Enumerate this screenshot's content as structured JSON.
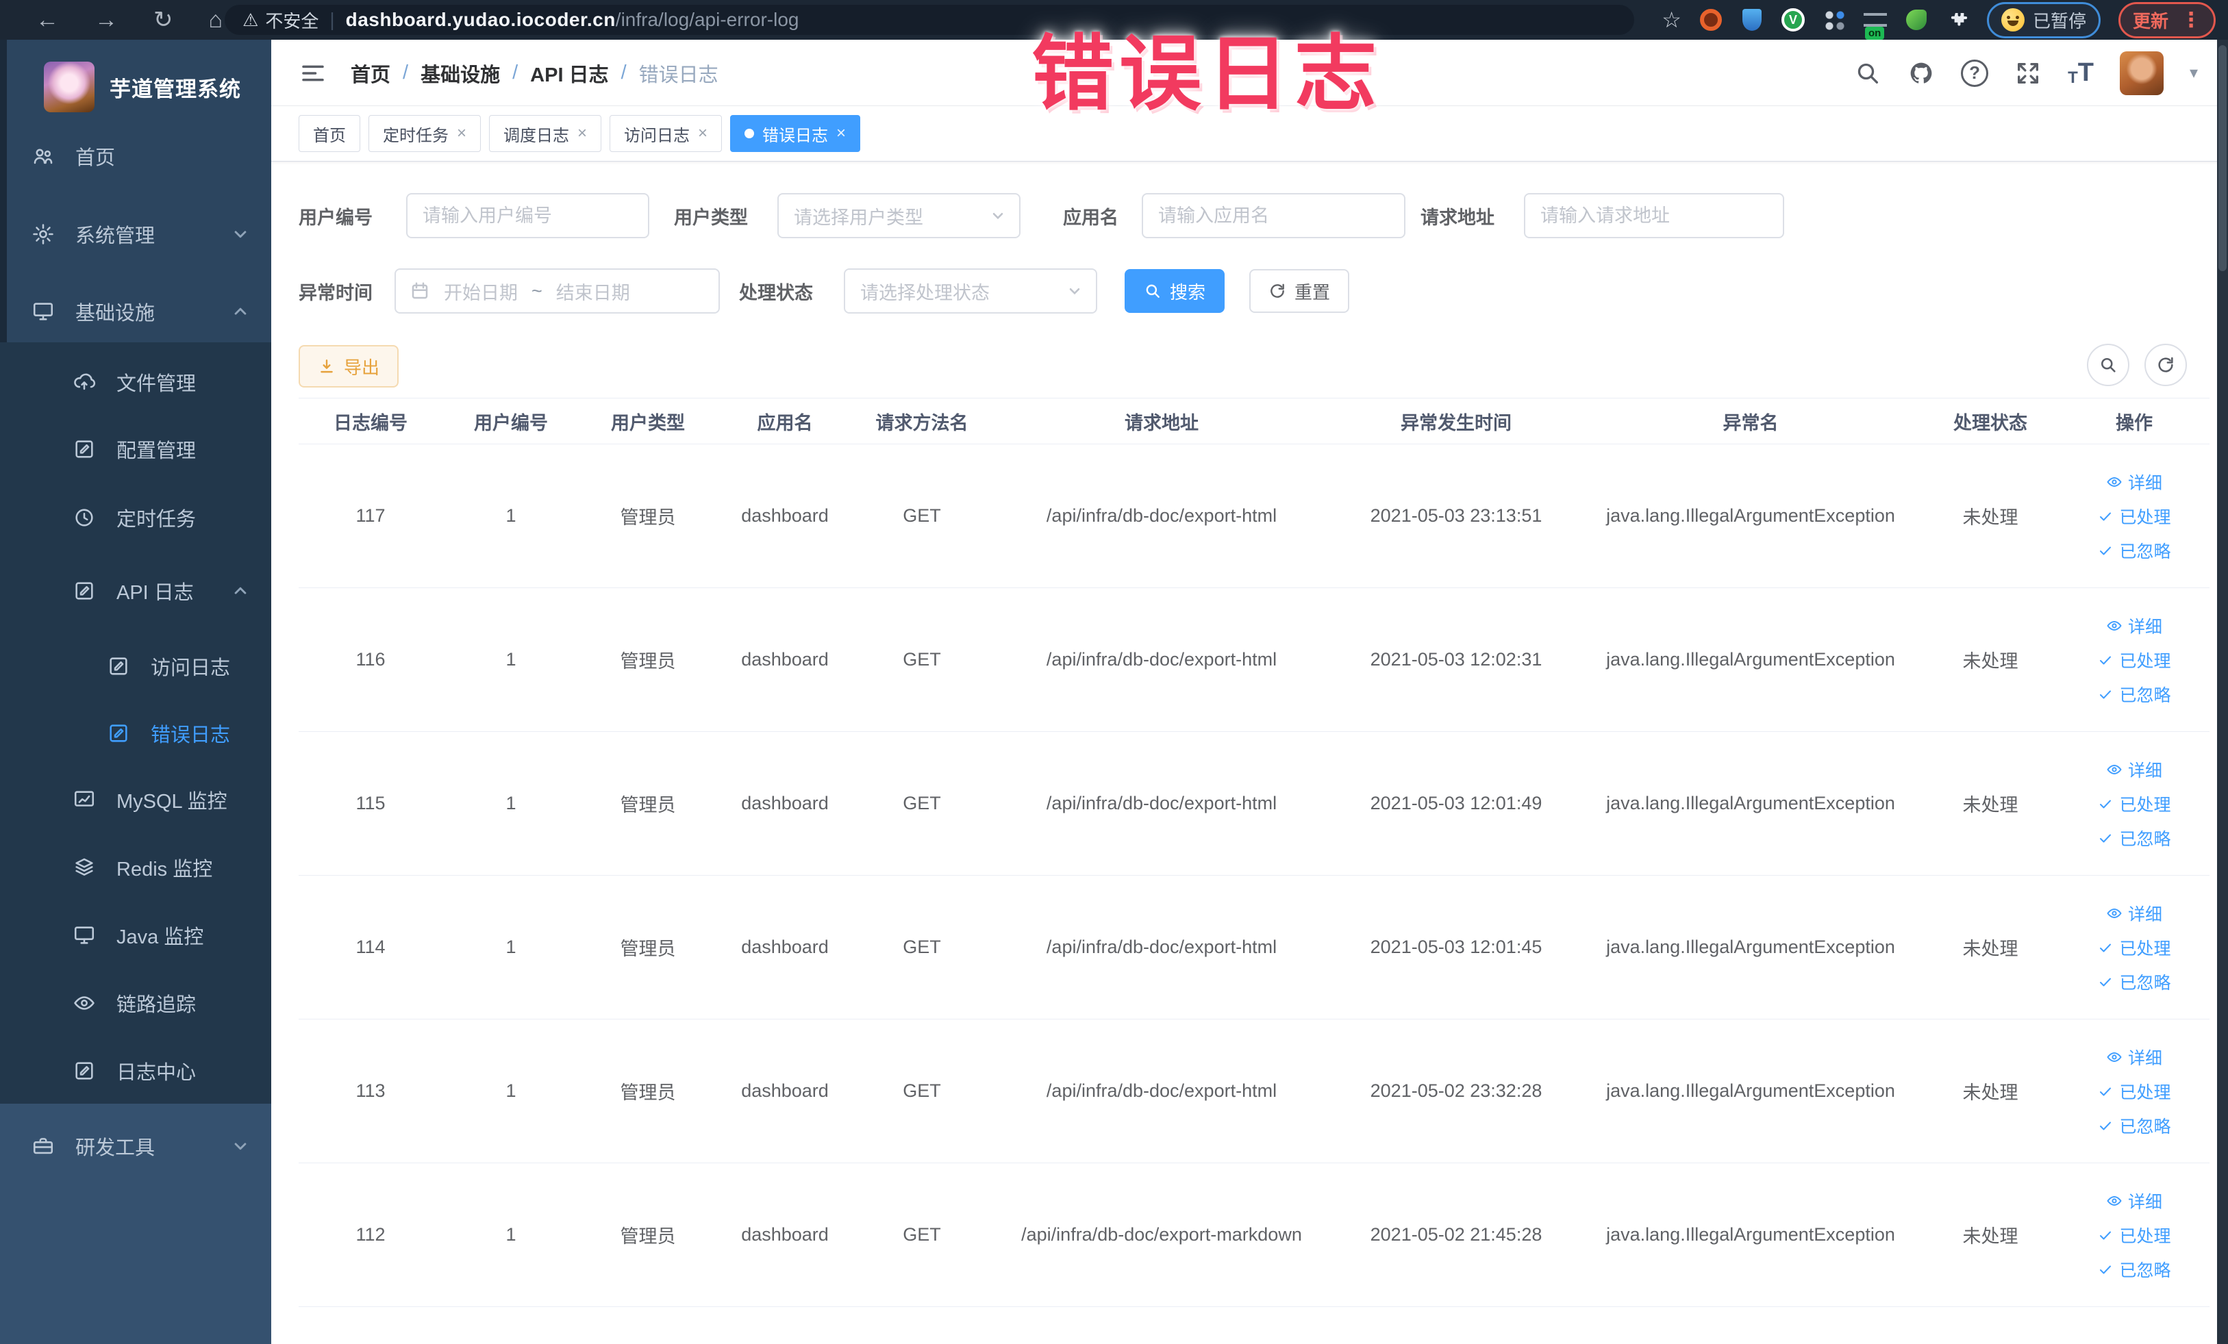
{
  "watermark_text": "错误日志",
  "browser": {
    "security_label": "不安全",
    "url_domain": "dashboard.yudao.iocoder.cn",
    "url_path": "/infra/log/api-error-log",
    "paused_badge_label": "已暂停",
    "update_button_label": "更新"
  },
  "glyphs": {
    "back": "←",
    "forward": "→",
    "reload": "↻",
    "home": "⌂",
    "star": "☆",
    "warning": "⚠",
    "pipe": "|",
    "more": "⋮",
    "caret": "▾",
    "close": "×",
    "separator": "/",
    "range_separator": "~",
    "question": "?",
    "ext_on": "on",
    "ext_v": "V"
  },
  "sidebar": {
    "title": "芋道管理系统",
    "items": [
      {
        "label": "首页"
      },
      {
        "label": "系统管理"
      },
      {
        "label": "基础设施"
      },
      {
        "label": "文件管理"
      },
      {
        "label": "配置管理"
      },
      {
        "label": "定时任务"
      },
      {
        "label": "API 日志"
      },
      {
        "label": "访问日志"
      },
      {
        "label": "错误日志"
      },
      {
        "label": "MySQL 监控"
      },
      {
        "label": "Redis 监控"
      },
      {
        "label": "Java 监控"
      },
      {
        "label": "链路追踪"
      },
      {
        "label": "日志中心"
      },
      {
        "label": "研发工具"
      }
    ]
  },
  "breadcrumb": {
    "items": [
      "首页",
      "基础设施",
      "API 日志",
      "错误日志"
    ]
  },
  "tabs": [
    {
      "label": "首页"
    },
    {
      "label": "定时任务"
    },
    {
      "label": "调度日志"
    },
    {
      "label": "访问日志"
    },
    {
      "label": "错误日志"
    }
  ],
  "filters": {
    "user_id_label": "用户编号",
    "user_id_placeholder": "请输入用户编号",
    "user_type_label": "用户类型",
    "user_type_placeholder": "请选择用户类型",
    "app_name_label": "应用名",
    "app_name_placeholder": "请输入应用名",
    "request_url_label": "请求地址",
    "request_url_placeholder": "请输入请求地址",
    "exception_time_label": "异常时间",
    "start_date_placeholder": "开始日期",
    "end_date_placeholder": "结束日期",
    "process_status_label": "处理状态",
    "process_status_placeholder": "请选择处理状态",
    "search_button_label": "搜索",
    "reset_button_label": "重置"
  },
  "toolbar": {
    "export_button_label": "导出"
  },
  "table": {
    "columns": [
      "日志编号",
      "用户编号",
      "用户类型",
      "应用名",
      "请求方法名",
      "请求地址",
      "异常发生时间",
      "异常名",
      "处理状态",
      "操作"
    ],
    "action_labels": [
      "详细",
      "已处理",
      "已忽略"
    ],
    "rows": [
      {
        "log_id": "117",
        "user_id": "1",
        "user_type": "管理员",
        "app_name": "dashboard",
        "method": "GET",
        "request_url": "/api/infra/db-doc/export-html",
        "time": "2021-05-03 23:13:51",
        "exception_name": "java.lang.IllegalArgumentException",
        "status": "未处理"
      },
      {
        "log_id": "116",
        "user_id": "1",
        "user_type": "管理员",
        "app_name": "dashboard",
        "method": "GET",
        "request_url": "/api/infra/db-doc/export-html",
        "time": "2021-05-03 12:02:31",
        "exception_name": "java.lang.IllegalArgumentException",
        "status": "未处理"
      },
      {
        "log_id": "115",
        "user_id": "1",
        "user_type": "管理员",
        "app_name": "dashboard",
        "method": "GET",
        "request_url": "/api/infra/db-doc/export-html",
        "time": "2021-05-03 12:01:49",
        "exception_name": "java.lang.IllegalArgumentException",
        "status": "未处理"
      },
      {
        "log_id": "114",
        "user_id": "1",
        "user_type": "管理员",
        "app_name": "dashboard",
        "method": "GET",
        "request_url": "/api/infra/db-doc/export-html",
        "time": "2021-05-03 12:01:45",
        "exception_name": "java.lang.IllegalArgumentException",
        "status": "未处理"
      },
      {
        "log_id": "113",
        "user_id": "1",
        "user_type": "管理员",
        "app_name": "dashboard",
        "method": "GET",
        "request_url": "/api/infra/db-doc/export-html",
        "time": "2021-05-02 23:32:28",
        "exception_name": "java.lang.IllegalArgumentException",
        "status": "未处理"
      },
      {
        "log_id": "112",
        "user_id": "1",
        "user_type": "管理员",
        "app_name": "dashboard",
        "method": "GET",
        "request_url": "/api/infra/db-doc/export-markdown",
        "time": "2021-05-02 21:45:28",
        "exception_name": "java.lang.IllegalArgumentException",
        "status": "未处理"
      }
    ]
  },
  "colors": {
    "accent": "#409eff",
    "watermark": "#f23a5f",
    "warning_text": "#e6a23c",
    "sidebar_bg": "#2c455f",
    "sidebar_submenu_bg": "#22374b",
    "sidebar_light_bg": "#35516f",
    "browser_bar_bg": "#1c2734"
  }
}
